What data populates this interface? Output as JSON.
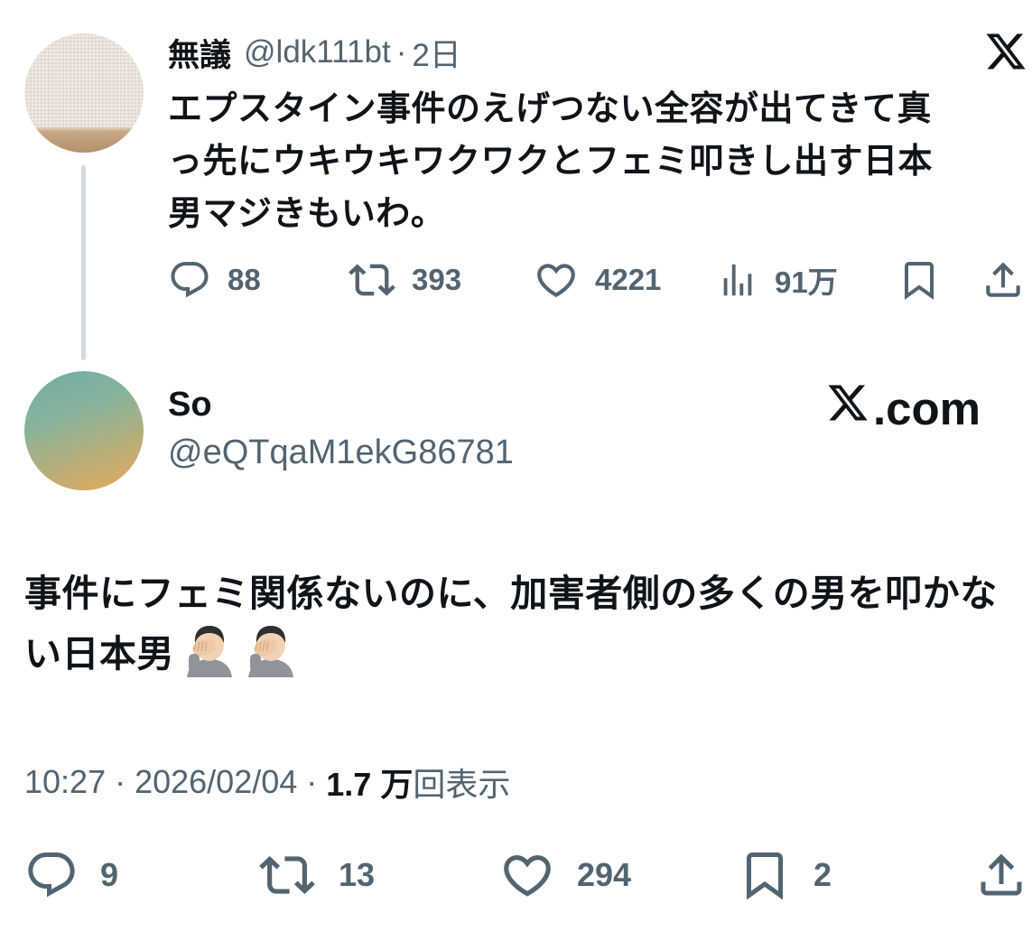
{
  "parent_tweet": {
    "display_name": "無議",
    "handle": "@ldk111bt",
    "dot": "·",
    "time_ago": "2日",
    "text_lines": [
      "エプスタイン事件のえげつない全容が出てきて真",
      "っ先にウキウキワクワクとフェミ叩きし出す日本",
      "男マジきもいわ。"
    ],
    "actions": {
      "replies": "88",
      "retweets": "393",
      "likes": "4221",
      "views": "91万"
    }
  },
  "main_tweet": {
    "display_name": "So",
    "handle": "@eQTqaM1ekG86781",
    "site_label": ".com",
    "text": "事件にフェミ関係ないのに、加害者側の多くの男を叩かない日本男",
    "emoji_count": 2,
    "emoji": "face-palm",
    "time": "10:27",
    "date": "2026/02/04",
    "separator": "·",
    "view_count": "1.7 万",
    "view_label": "回表示",
    "actions": {
      "replies": "9",
      "retweets": "13",
      "likes": "294",
      "bookmarks": "2"
    }
  },
  "icons": {
    "reply": "reply-icon",
    "retweet": "retweet-icon",
    "like": "like-icon",
    "views": "views-icon",
    "bookmark": "bookmark-icon",
    "share": "share-icon",
    "logo": "x-logo-icon"
  },
  "colors": {
    "text_primary": "#0f1419",
    "text_secondary": "#536471",
    "thread_line": "#cfd9de"
  }
}
